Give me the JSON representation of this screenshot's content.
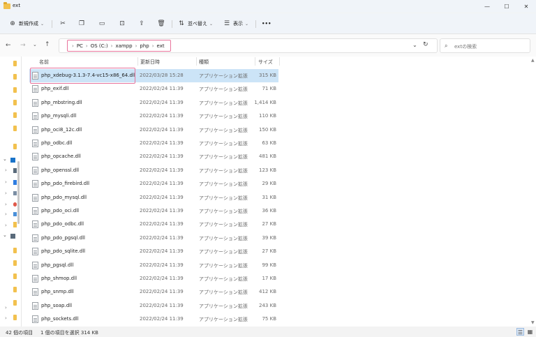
{
  "window": {
    "title": "ext",
    "minimize_glyph": "—",
    "maximize_glyph": "☐",
    "close_glyph": "✕"
  },
  "toolbar": {
    "new_label": "新規作成",
    "sort_label": "並べ替え",
    "view_label": "表示",
    "more_glyph": "•••"
  },
  "breadcrumb": {
    "items": [
      "PC",
      "OS (C:)",
      "xampp",
      "php",
      "ext"
    ]
  },
  "search": {
    "placeholder": "extの検索"
  },
  "columns": {
    "name": "名前",
    "date": "更新日時",
    "type": "種類",
    "size": "サイズ"
  },
  "files": [
    {
      "name": "php_xdebug-3.1.3-7.4-vc15-x86_64.dll",
      "date": "2022/03/28 15:28",
      "type": "アプリケーション拡張",
      "size": "315 KB",
      "selected": true
    },
    {
      "name": "php_exif.dll",
      "date": "2022/02/24 11:39",
      "type": "アプリケーション拡張",
      "size": "71 KB"
    },
    {
      "name": "php_mbstring.dll",
      "date": "2022/02/24 11:39",
      "type": "アプリケーション拡張",
      "size": "1,414 KB"
    },
    {
      "name": "php_mysqli.dll",
      "date": "2022/02/24 11:39",
      "type": "アプリケーション拡張",
      "size": "110 KB"
    },
    {
      "name": "php_oci8_12c.dll",
      "date": "2022/02/24 11:39",
      "type": "アプリケーション拡張",
      "size": "150 KB"
    },
    {
      "name": "php_odbc.dll",
      "date": "2022/02/24 11:39",
      "type": "アプリケーション拡張",
      "size": "63 KB"
    },
    {
      "name": "php_opcache.dll",
      "date": "2022/02/24 11:39",
      "type": "アプリケーション拡張",
      "size": "481 KB"
    },
    {
      "name": "php_openssl.dll",
      "date": "2022/02/24 11:39",
      "type": "アプリケーション拡張",
      "size": "123 KB"
    },
    {
      "name": "php_pdo_firebird.dll",
      "date": "2022/02/24 11:39",
      "type": "アプリケーション拡張",
      "size": "29 KB"
    },
    {
      "name": "php_pdo_mysql.dll",
      "date": "2022/02/24 11:39",
      "type": "アプリケーション拡張",
      "size": "31 KB"
    },
    {
      "name": "php_pdo_oci.dll",
      "date": "2022/02/24 11:39",
      "type": "アプリケーション拡張",
      "size": "36 KB"
    },
    {
      "name": "php_pdo_odbc.dll",
      "date": "2022/02/24 11:39",
      "type": "アプリケーション拡張",
      "size": "27 KB"
    },
    {
      "name": "php_pdo_pgsql.dll",
      "date": "2022/02/24 11:39",
      "type": "アプリケーション拡張",
      "size": "39 KB"
    },
    {
      "name": "php_pdo_sqlite.dll",
      "date": "2022/02/24 11:39",
      "type": "アプリケーション拡張",
      "size": "27 KB"
    },
    {
      "name": "php_pgsql.dll",
      "date": "2022/02/24 11:39",
      "type": "アプリケーション拡張",
      "size": "99 KB"
    },
    {
      "name": "php_shmop.dll",
      "date": "2022/02/24 11:39",
      "type": "アプリケーション拡張",
      "size": "17 KB"
    },
    {
      "name": "php_snmp.dll",
      "date": "2022/02/24 11:39",
      "type": "アプリケーション拡張",
      "size": "412 KB"
    },
    {
      "name": "php_soap.dll",
      "date": "2022/02/24 11:39",
      "type": "アプリケーション拡張",
      "size": "243 KB"
    },
    {
      "name": "php_sockets.dll",
      "date": "2022/02/24 11:39",
      "type": "アプリケーション拡張",
      "size": "75 KB"
    }
  ],
  "status": {
    "item_count": "42 個の項目",
    "selection": "1 個の項目を選択  314 KB"
  },
  "colors": {
    "selection": "#cce4f7",
    "highlight_border": "#e8749c",
    "folder": "#f2c14e"
  }
}
